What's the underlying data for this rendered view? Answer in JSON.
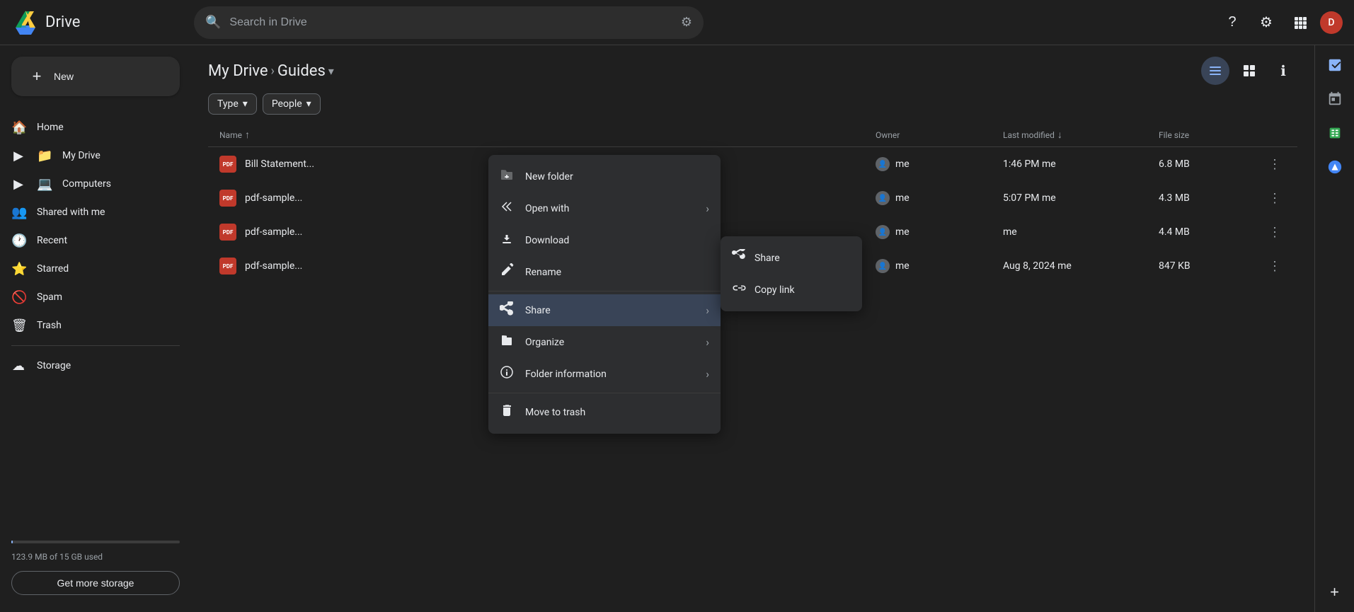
{
  "topbar": {
    "logo_text": "Drive",
    "search_placeholder": "Search in Drive",
    "help_icon": "?",
    "settings_icon": "⚙",
    "apps_icon": "⋮⋮⋮",
    "avatar_label": "D"
  },
  "sidebar": {
    "new_button_label": "New",
    "items": [
      {
        "id": "home",
        "label": "Home",
        "icon": "🏠"
      },
      {
        "id": "my-drive",
        "label": "My Drive",
        "icon": "📁",
        "expandable": true
      },
      {
        "id": "computers",
        "label": "Computers",
        "icon": "💻",
        "expandable": true
      },
      {
        "id": "shared-with-me",
        "label": "Shared with me",
        "icon": "👤"
      },
      {
        "id": "recent",
        "label": "Recent",
        "icon": "🕐"
      },
      {
        "id": "starred",
        "label": "Starred",
        "icon": "⭐"
      },
      {
        "id": "spam",
        "label": "Spam",
        "icon": "🚫"
      },
      {
        "id": "trash",
        "label": "Trash",
        "icon": "🗑"
      },
      {
        "id": "storage",
        "label": "Storage",
        "icon": "☁"
      }
    ],
    "storage": {
      "text": "123.9 MB of 15 GB used",
      "get_more_label": "Get more storage",
      "fill_percent": "1%"
    }
  },
  "header": {
    "breadcrumb_root": "My Drive",
    "breadcrumb_current": "Guides",
    "dropdown_icon": "▾",
    "arrow_icon": "›"
  },
  "filters": {
    "type_label": "Type",
    "people_label": "People",
    "dropdown_icon": "▾"
  },
  "view": {
    "list_view_active": true,
    "info_icon": "ℹ"
  },
  "table": {
    "columns": [
      {
        "id": "name",
        "label": "Name",
        "sort": true,
        "sort_icon": "↑"
      },
      {
        "id": "owner",
        "label": "Owner",
        "sort": false
      },
      {
        "id": "last_modified",
        "label": "Last modified",
        "sort": true,
        "sort_icon": "↓"
      },
      {
        "id": "file_size",
        "label": "File size",
        "sort": false
      }
    ],
    "rows": [
      {
        "id": "row1",
        "name": "Bill Statement...",
        "type": "pdf",
        "owner": "me",
        "last_modified": "1:46 PM  me",
        "file_size": "6.8 MB"
      },
      {
        "id": "row2",
        "name": "pdf-sample...",
        "type": "pdf",
        "owner": "me",
        "last_modified": "5:07 PM  me",
        "file_size": "4.3 MB"
      },
      {
        "id": "row3",
        "name": "pdf-sample...",
        "type": "pdf",
        "owner": "me",
        "last_modified": "me",
        "file_size": "4.4 MB"
      },
      {
        "id": "row4",
        "name": "pdf-sample...",
        "type": "pdf",
        "owner": "me",
        "last_modified": "Aug 8, 2024  me",
        "file_size": "847 KB"
      }
    ]
  },
  "context_menu": {
    "items": [
      {
        "id": "new-folder",
        "label": "New folder",
        "icon": "📁",
        "has_submenu": false
      },
      {
        "id": "open-with",
        "label": "Open with",
        "icon": "↗",
        "has_submenu": true
      },
      {
        "id": "download",
        "label": "Download",
        "icon": "⬇",
        "has_submenu": false
      },
      {
        "id": "rename",
        "label": "Rename",
        "icon": "✏",
        "has_submenu": false
      },
      {
        "id": "share",
        "label": "Share",
        "icon": "👤+",
        "has_submenu": true,
        "active": true
      },
      {
        "id": "organize",
        "label": "Organize",
        "icon": "📂",
        "has_submenu": true
      },
      {
        "id": "folder-info",
        "label": "Folder information",
        "icon": "ℹ",
        "has_submenu": true
      },
      {
        "id": "move-to-trash",
        "label": "Move to trash",
        "icon": "🗑",
        "has_submenu": false
      }
    ]
  },
  "submenu": {
    "items": [
      {
        "id": "share-share",
        "label": "Share",
        "icon": "👤+"
      },
      {
        "id": "copy-link",
        "label": "Copy link",
        "icon": "🔗"
      }
    ]
  },
  "right_panel": {
    "icons": [
      {
        "id": "activity",
        "symbol": "📊",
        "active": true
      },
      {
        "id": "calendar",
        "symbol": "📅",
        "active": false
      },
      {
        "id": "edit",
        "symbol": "✏",
        "active": true
      },
      {
        "id": "add",
        "symbol": "+"
      }
    ]
  }
}
